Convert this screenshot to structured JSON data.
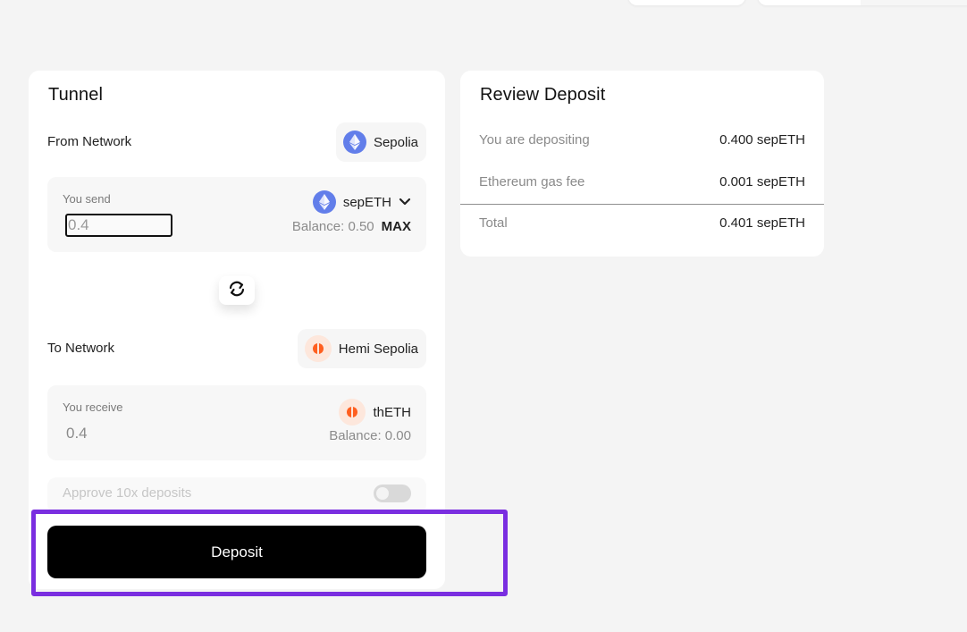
{
  "tunnel": {
    "title": "Tunnel",
    "from_label": "From Network",
    "from_network": "Sepolia",
    "send": {
      "label": "You send",
      "value": "0.4",
      "placeholder": "0.4",
      "token": "sepETH",
      "balance": "Balance: 0.50",
      "max_label": "MAX"
    },
    "to_label": "To Network",
    "to_network": "Hemi Sepolia",
    "receive": {
      "label": "You receive",
      "value": "0.4",
      "token": "thETH",
      "balance": "Balance: 0.00"
    },
    "approve_label": "Approve 10x deposits",
    "approve_enabled": false,
    "deposit_label": "Deposit"
  },
  "review": {
    "title": "Review Deposit",
    "rows": [
      {
        "label": "You are depositing",
        "value": "0.400 sepETH"
      },
      {
        "label": "Ethereum gas fee",
        "value": "0.001 sepETH"
      },
      {
        "label": "Total",
        "value": "0.401 sepETH"
      }
    ]
  },
  "icons": {
    "eth": "ethereum-icon",
    "hemi": "hemi-icon",
    "swap": "swap-arrows-icon",
    "chevron": "chevron-down-icon"
  },
  "colors": {
    "eth": "#627eea",
    "hemi": "#ff5f1f",
    "highlight": "#7a2ee0",
    "primary_button": "#000000"
  }
}
